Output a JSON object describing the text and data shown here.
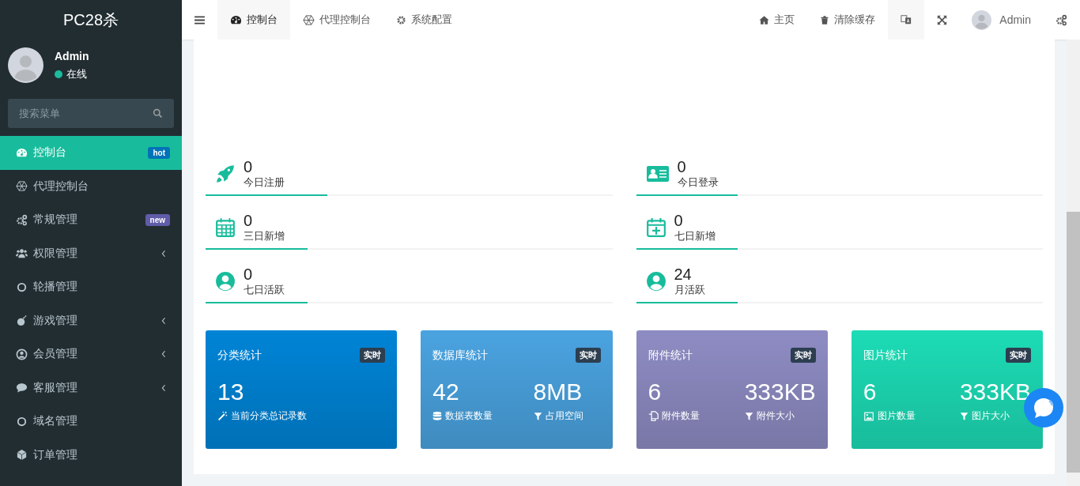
{
  "sidebar": {
    "logo": "PC28杀",
    "user": {
      "name": "Admin",
      "status": "在线"
    },
    "search": {
      "placeholder": "搜索菜单"
    },
    "items": [
      {
        "label": "控制台",
        "selected": true,
        "badge": {
          "text": "hot",
          "color": "#0073b7"
        },
        "expandable": false
      },
      {
        "label": "代理控制台",
        "selected": false,
        "expandable": false
      },
      {
        "label": "常规管理",
        "selected": false,
        "badge": {
          "text": "new",
          "color": "#605ca8"
        },
        "expandable": false
      },
      {
        "label": "权限管理",
        "selected": false,
        "expandable": true
      },
      {
        "label": "轮播管理",
        "selected": false,
        "expandable": false
      },
      {
        "label": "游戏管理",
        "selected": false,
        "expandable": true
      },
      {
        "label": "会员管理",
        "selected": false,
        "expandable": true
      },
      {
        "label": "客服管理",
        "selected": false,
        "expandable": true
      },
      {
        "label": "域名管理",
        "selected": false,
        "expandable": false
      },
      {
        "label": "订单管理",
        "selected": false,
        "expandable": false
      }
    ]
  },
  "topbar": {
    "tabs": [
      {
        "label": "控制台",
        "selected": true
      },
      {
        "label": "代理控制台",
        "selected": false
      },
      {
        "label": "系统配置",
        "selected": false
      }
    ],
    "links": [
      "主页",
      "清除缓存"
    ],
    "user": "Admin"
  },
  "stats": [
    {
      "value": "0",
      "label": "今日注册",
      "level": 0.3
    },
    {
      "value": "0",
      "label": "今日登录",
      "level": 0.25
    },
    {
      "value": "0",
      "label": "三日新增",
      "level": 0.25
    },
    {
      "value": "0",
      "label": "七日新增",
      "level": 0.25
    },
    {
      "value": "0",
      "label": "七日活跃",
      "level": 0.25
    },
    {
      "value": "24",
      "label": "月活跃",
      "level": 0.25
    }
  ],
  "cards": [
    {
      "title": "分类统计",
      "badge": "实时",
      "color": "#0084d6",
      "metrics": [
        {
          "value": "13",
          "label": "当前分类总记录数"
        }
      ]
    },
    {
      "title": "数据库统计",
      "badge": "实时",
      "color": "#4aa3e0",
      "metrics": [
        {
          "value": "42",
          "label": "数据表数量"
        },
        {
          "value": "8MB",
          "label": "占用空间"
        }
      ]
    },
    {
      "title": "附件统计",
      "badge": "实时",
      "color": "#8e8cc3",
      "metrics": [
        {
          "value": "6",
          "label": "附件数量"
        },
        {
          "value": "333KB",
          "label": "附件大小"
        }
      ]
    },
    {
      "title": "图片统计",
      "badge": "实时",
      "color": "#1ddcb6",
      "metrics": [
        {
          "value": "6",
          "label": "图片数量"
        },
        {
          "value": "333KB",
          "label": "图片大小"
        }
      ]
    }
  ]
}
